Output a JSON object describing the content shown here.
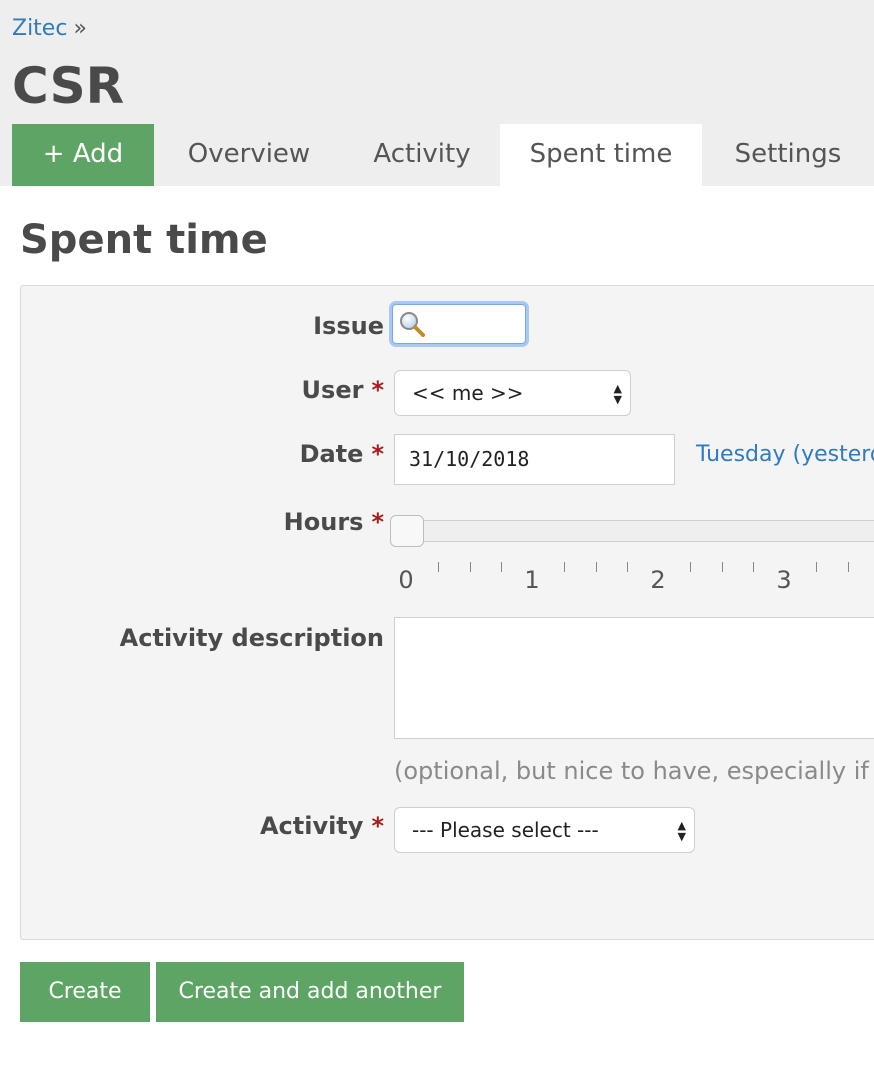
{
  "breadcrumb": {
    "parent": "Zitec",
    "separator": "»"
  },
  "project": {
    "title": "CSR"
  },
  "tabs": {
    "add": "+ Add",
    "overview": "Overview",
    "activity": "Activity",
    "spent_time": "Spent time",
    "settings": "Settings",
    "active": "Spent time"
  },
  "page": {
    "heading": "Spent time"
  },
  "form": {
    "issue": {
      "label": "Issue",
      "value": ""
    },
    "user": {
      "label": "User",
      "required_mark": "*",
      "selected": "<< me >>"
    },
    "date": {
      "label": "Date",
      "required_mark": "*",
      "value": "31/10/2018",
      "hint": "Tuesday (yesterd"
    },
    "hours": {
      "label": "Hours",
      "required_mark": "*",
      "value": 0,
      "tick_labels": [
        "0",
        "1",
        "2",
        "3"
      ]
    },
    "description": {
      "label": "Activity description",
      "value": "",
      "hint": "(optional, but nice to have, especially if t"
    },
    "activity": {
      "label": "Activity",
      "required_mark": "*",
      "selected": "--- Please select ---"
    }
  },
  "buttons": {
    "create": "Create",
    "create_another": "Create and add another"
  },
  "colors": {
    "accent_green": "#5ea565",
    "link_blue": "#2e7bc0",
    "required_red": "#a61d1d",
    "focus_blue": "#a8c8f5"
  },
  "icons": {
    "issue_search": "magnifier-icon",
    "select_arrows": "up-down-arrows-icon"
  }
}
